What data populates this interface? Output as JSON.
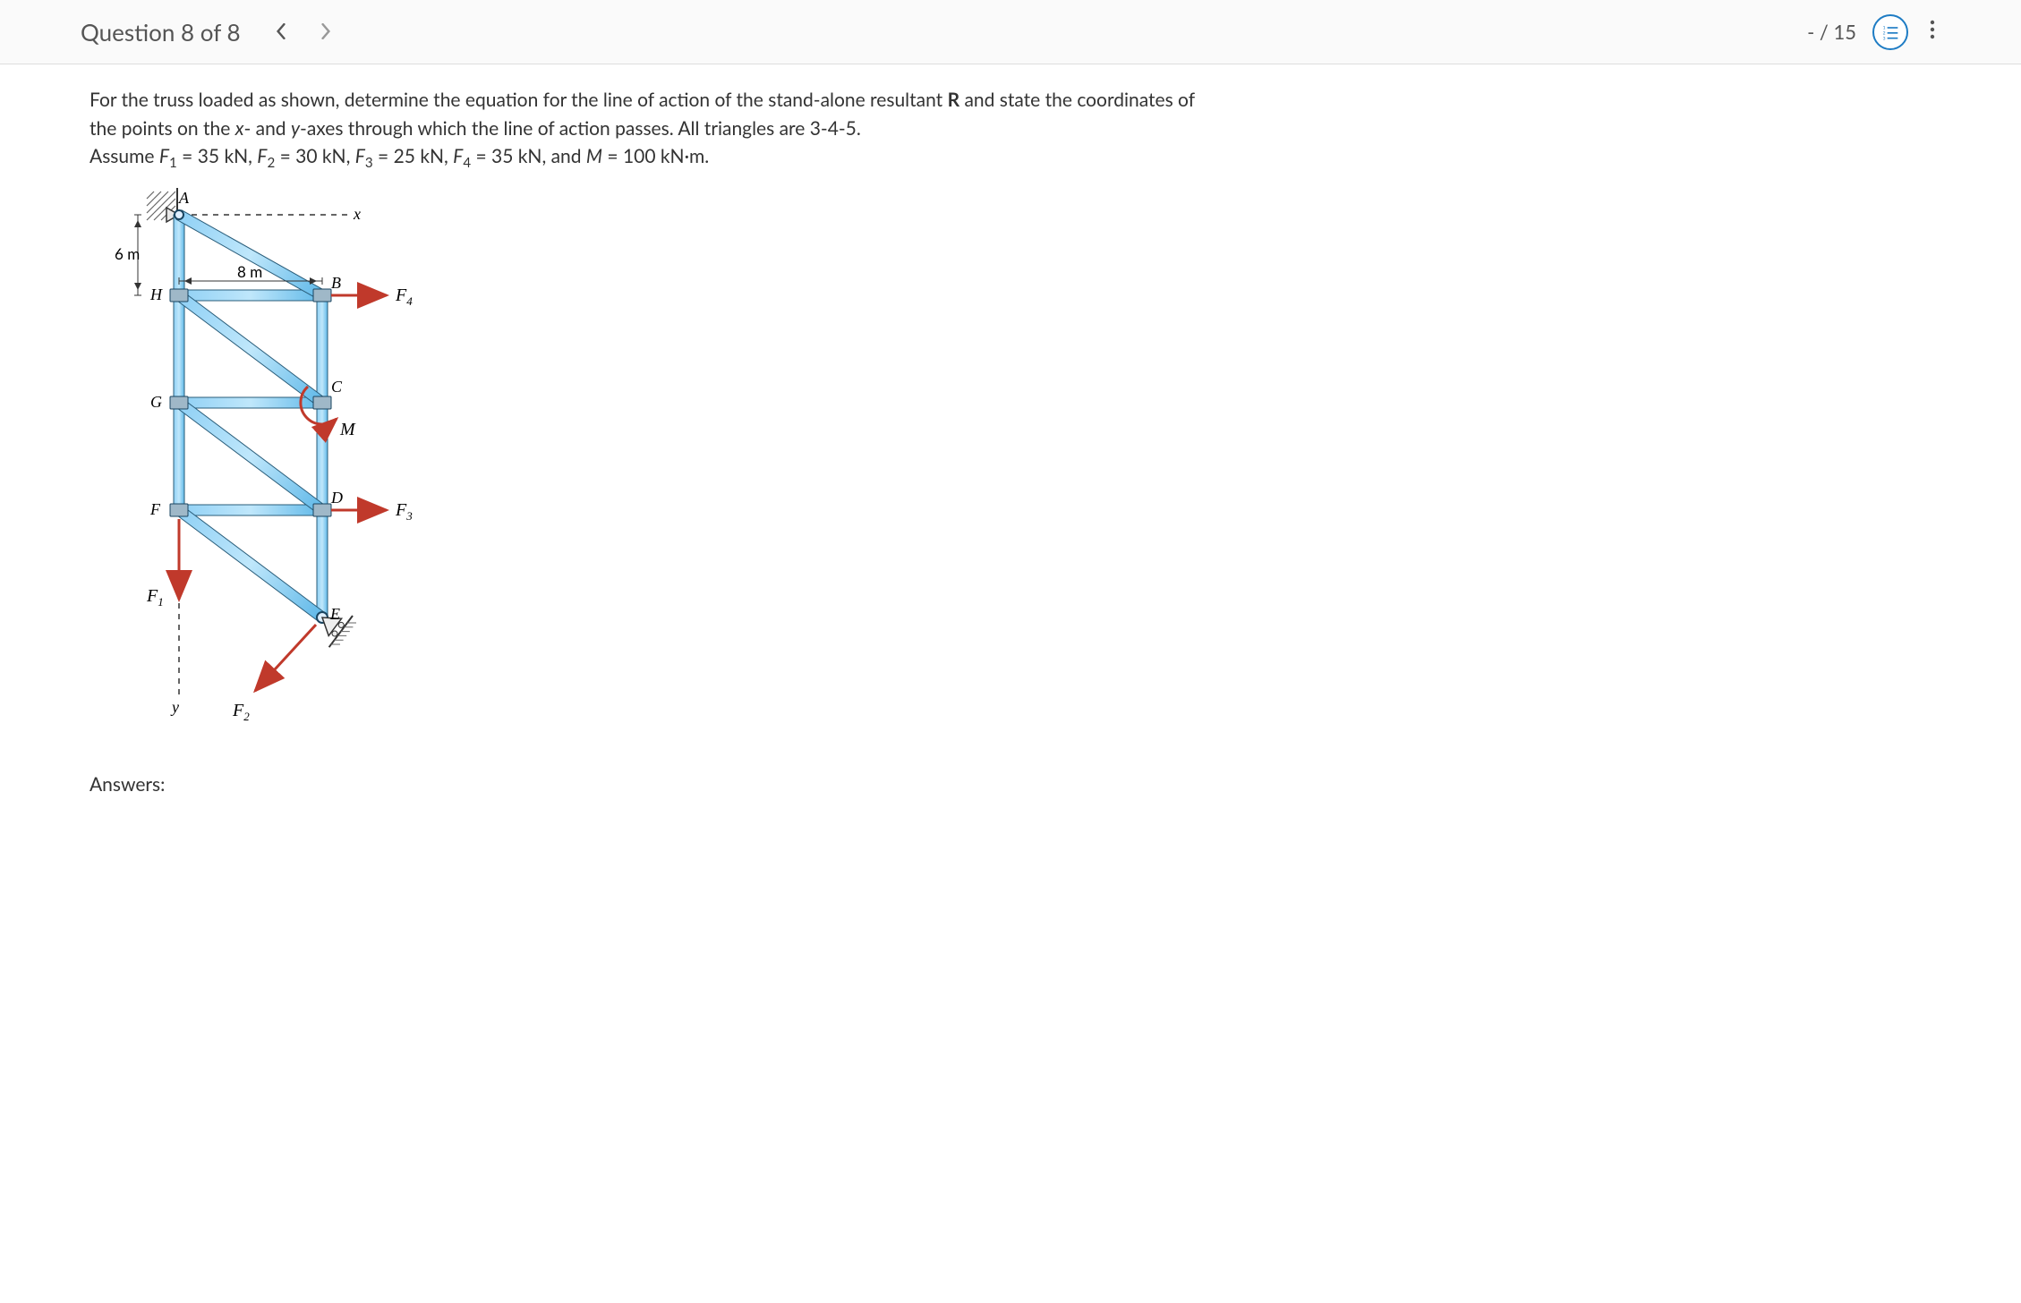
{
  "header": {
    "title": "Question 8 of 8",
    "score": "- / 15"
  },
  "problem": {
    "p1a": "For the truss loaded as shown, determine the equation for the line of action of the stand-alone resultant ",
    "p1b": " and state the coordinates of the points on the ",
    "p1c": "- and ",
    "p1d": "-axes through which the line of action passes. All triangles are 3-4-5.",
    "p2a": "Assume ",
    "f1_label": "F",
    "f1_sub": "1",
    "eq": " = ",
    "v1": "35 kN, ",
    "f2_sub": "2",
    "v2": "30 kN, ",
    "f3_sub": "3",
    "v3": "25 kN, ",
    "f4_sub": "4",
    "v4": "35 kN, and ",
    "M_label": "M",
    "vM": "100 kN·m.",
    "R": "R",
    "x": "x",
    "y": "y"
  },
  "figure": {
    "dim_6m": "6 m",
    "dim_8m": "8 m",
    "A": "A",
    "B": "B",
    "C": "C",
    "D": "D",
    "E": "E",
    "F": "F",
    "G": "G",
    "H": "H",
    "x": "x",
    "y": "y",
    "M": "M",
    "F1": "F",
    "F1s": "1",
    "F2": "F",
    "F2s": "2",
    "F3": "F",
    "F3s": "3",
    "F4": "F",
    "F4s": "4"
  },
  "answers_label": "Answers:"
}
